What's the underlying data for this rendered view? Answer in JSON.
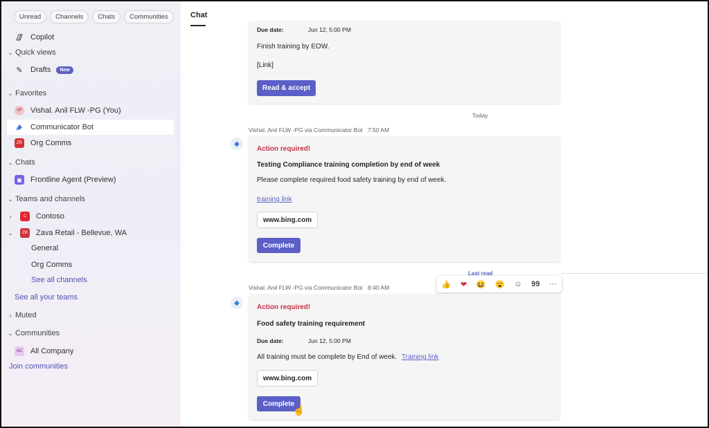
{
  "filters": [
    "Unread",
    "Channels",
    "Chats",
    "Communities"
  ],
  "sidebar": {
    "copilot": "Copilot",
    "quick_views": "Quick views",
    "drafts": "Drafts",
    "drafts_badge": "New",
    "favorites": "Favorites",
    "favorites_items": [
      {
        "label": "Vishal. Anil FLW -PG (You)",
        "initials": "VF"
      },
      {
        "label": "Communicator Bot"
      },
      {
        "label": "Org Comms",
        "initials": "ZR"
      }
    ],
    "chats": "Chats",
    "chat_items": [
      {
        "label": "Frontline Agent (Preview)"
      }
    ],
    "teams_and_channels": "Teams and channels",
    "teams": [
      {
        "label": "Contoso",
        "initials": "C"
      },
      {
        "label": "Zava Retail - Bellevue, WA",
        "initials": "ZR"
      }
    ],
    "channels": [
      "General",
      "Org Comms"
    ],
    "see_all_channels": "See all channels",
    "see_all_teams": "See all your teams",
    "muted": "Muted",
    "communities": "Communities",
    "community_items": [
      {
        "label": "All Company",
        "initials": "AC"
      }
    ],
    "join_communities": "Join communities"
  },
  "main": {
    "tab": "Chat",
    "card0": {
      "due_label": "Due date:",
      "due_value": "Jun 12, 5:00 PM",
      "text": "Finish training by EOW.",
      "link": "[Link]",
      "button": "Read & accept"
    },
    "day_divider": "Today",
    "msg1": {
      "sender": "Vishal. Anil FLW -PG via Communicator Bot",
      "time": "7:50 AM",
      "action": "Action required!",
      "title": "Testing Compliance training completion by end of week",
      "body": "Please complete required food safety training by end of week.",
      "link": "training link",
      "url_button": "www.bing.com",
      "button": "Complete"
    },
    "last_read": "Last read",
    "reactions": [
      "👍",
      "❤",
      "😆",
      "😮",
      "☺",
      "99",
      "···"
    ],
    "msg2": {
      "sender": "Vishal. Anil FLW -PG via Communicator Bot",
      "time": "8:40 AM",
      "action": "Action required!",
      "title": "Food safety training requirement",
      "due_label": "Due date:",
      "due_value": "Jun 12, 5:00 PM",
      "body": "All training must be complete by End of week.",
      "link": "Training link",
      "url_button": "www.bing.com",
      "button": "Complete"
    }
  }
}
